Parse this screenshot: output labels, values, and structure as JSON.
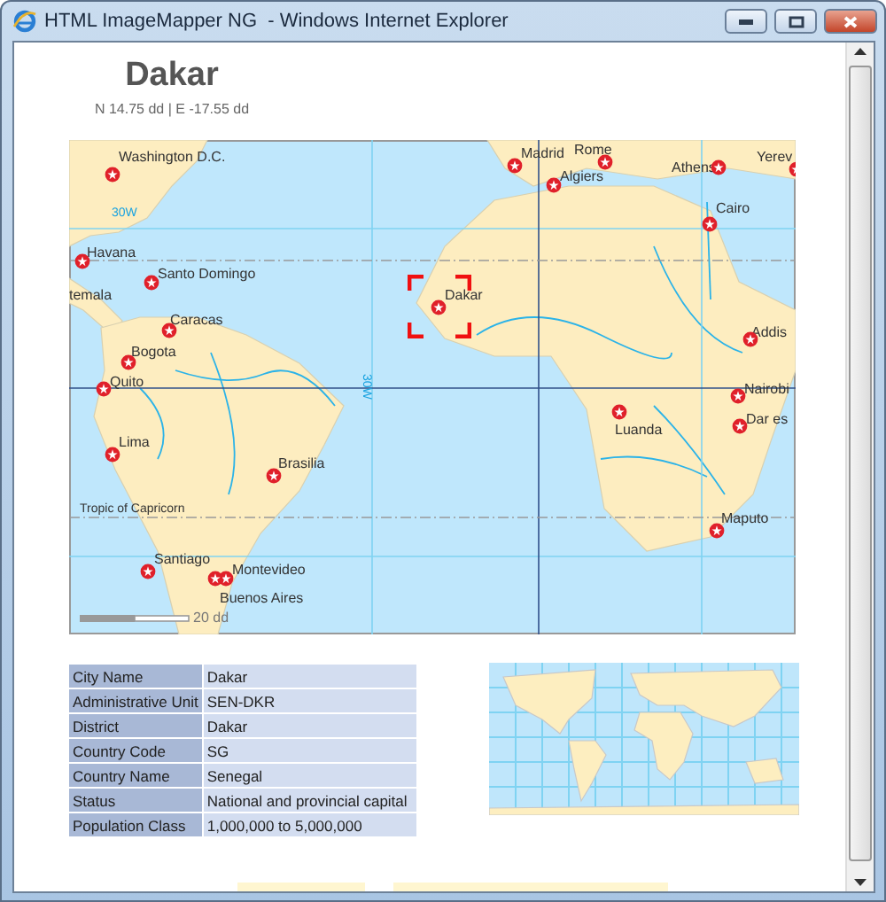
{
  "window": {
    "title": "HTML ImageMapper NG  - Windows Internet Explorer"
  },
  "heading": {
    "title": "Dakar",
    "coordinates": "N 14.75 dd | E -17.55 dd"
  },
  "map": {
    "cities": [
      {
        "name": "Washington D.C.",
        "selected": false
      },
      {
        "name": "Havana",
        "selected": false
      },
      {
        "name": "Santo Domingo",
        "selected": false
      },
      {
        "name": "temala",
        "selected": false
      },
      {
        "name": "Caracas",
        "selected": false
      },
      {
        "name": "Bogota",
        "selected": false
      },
      {
        "name": "Quito",
        "selected": false
      },
      {
        "name": "Lima",
        "selected": false
      },
      {
        "name": "Brasilia",
        "selected": false
      },
      {
        "name": "Santiago",
        "selected": false
      },
      {
        "name": "Montevideo",
        "selected": false
      },
      {
        "name": "Buenos Aires",
        "selected": false
      },
      {
        "name": "Dakar",
        "selected": true
      },
      {
        "name": "Madrid",
        "selected": false
      },
      {
        "name": "Algiers",
        "selected": false
      },
      {
        "name": "Rome",
        "selected": false
      },
      {
        "name": "Athens",
        "selected": false
      },
      {
        "name": "Yerev",
        "selected": false
      },
      {
        "name": "Cairo",
        "selected": false
      },
      {
        "name": "Addis",
        "selected": false
      },
      {
        "name": "Nairobi",
        "selected": false
      },
      {
        "name": "Dar es",
        "selected": false
      },
      {
        "name": "Luanda",
        "selected": false
      },
      {
        "name": "Maputo",
        "selected": false
      }
    ],
    "grid_labels": [
      "30W",
      "30W"
    ],
    "line_label": "Tropic of Capricorn",
    "scale_label": "20 dd"
  },
  "details": [
    {
      "field": "City Name",
      "value": "Dakar"
    },
    {
      "field": "Administrative Unit",
      "value": "SEN-DKR"
    },
    {
      "field": "District",
      "value": "Dakar"
    },
    {
      "field": "Country Code",
      "value": "SG"
    },
    {
      "field": "Country Name",
      "value": "Senegal"
    },
    {
      "field": "Status",
      "value": "National and provincial capital"
    },
    {
      "field": "Population Class",
      "value": "1,000,000 to 5,000,000"
    }
  ]
}
